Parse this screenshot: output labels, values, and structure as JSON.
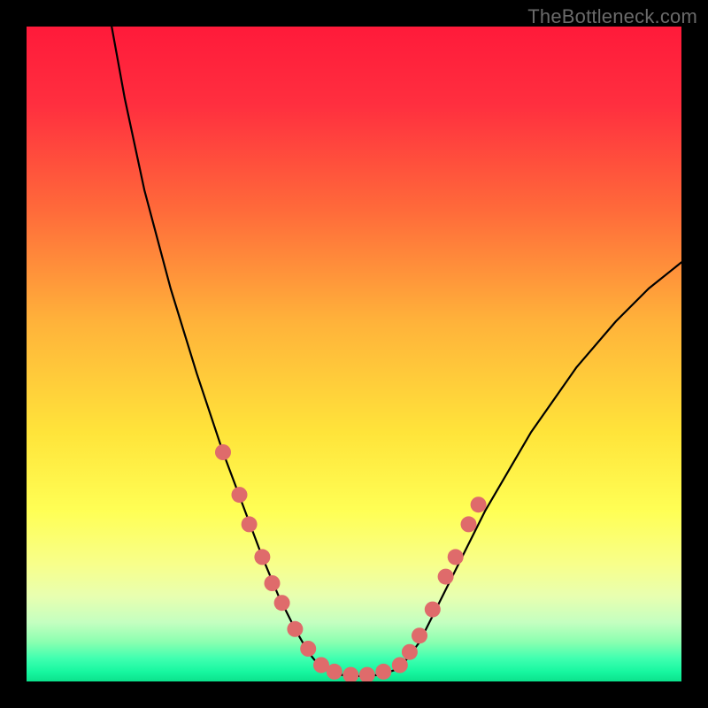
{
  "watermark": "TheBottleneck.com",
  "chart_data": {
    "type": "line",
    "title": "",
    "xlabel": "",
    "ylabel": "",
    "xlim": [
      0,
      100
    ],
    "ylim": [
      0,
      100
    ],
    "grid": false,
    "legend": false,
    "background_gradient_stops": [
      {
        "offset": 0.0,
        "color": "#ff1a3a"
      },
      {
        "offset": 0.12,
        "color": "#ff2f3f"
      },
      {
        "offset": 0.28,
        "color": "#ff6a3a"
      },
      {
        "offset": 0.45,
        "color": "#ffb23a"
      },
      {
        "offset": 0.62,
        "color": "#ffe43a"
      },
      {
        "offset": 0.74,
        "color": "#ffff55"
      },
      {
        "offset": 0.82,
        "color": "#f8ff8a"
      },
      {
        "offset": 0.87,
        "color": "#e8ffb0"
      },
      {
        "offset": 0.91,
        "color": "#c4ffc0"
      },
      {
        "offset": 0.94,
        "color": "#8affb0"
      },
      {
        "offset": 0.965,
        "color": "#3fffb0"
      },
      {
        "offset": 0.985,
        "color": "#17f7a0"
      },
      {
        "offset": 1.0,
        "color": "#0be28c"
      }
    ],
    "series": [
      {
        "name": "left-curve",
        "color": "#000000",
        "width": 2.2,
        "x": [
          13.0,
          15.0,
          18.0,
          22.0,
          26.0,
          30.0,
          33.0,
          36.0,
          38.5,
          41.0,
          43.0,
          45.0
        ],
        "y": [
          100.0,
          89.0,
          75.0,
          60.0,
          47.0,
          35.0,
          27.0,
          19.0,
          13.0,
          8.0,
          4.5,
          2.0
        ]
      },
      {
        "name": "valley-floor",
        "color": "#000000",
        "width": 2.2,
        "x": [
          45.0,
          48.0,
          51.0,
          54.0,
          57.0
        ],
        "y": [
          2.0,
          1.0,
          0.8,
          1.0,
          2.0
        ]
      },
      {
        "name": "right-curve",
        "color": "#000000",
        "width": 2.2,
        "x": [
          57.0,
          60.0,
          64.0,
          70.0,
          77.0,
          84.0,
          90.0,
          95.0,
          100.0
        ],
        "y": [
          2.0,
          6.0,
          14.0,
          26.0,
          38.0,
          48.0,
          55.0,
          60.0,
          64.0
        ]
      }
    ],
    "dots": {
      "name": "highlight-dots",
      "color": "#df6b6b",
      "radius": 9,
      "points": [
        {
          "x": 30.0,
          "y": 35.0
        },
        {
          "x": 32.5,
          "y": 28.5
        },
        {
          "x": 34.0,
          "y": 24.0
        },
        {
          "x": 36.0,
          "y": 19.0
        },
        {
          "x": 37.5,
          "y": 15.0
        },
        {
          "x": 39.0,
          "y": 12.0
        },
        {
          "x": 41.0,
          "y": 8.0
        },
        {
          "x": 43.0,
          "y": 5.0
        },
        {
          "x": 45.0,
          "y": 2.5
        },
        {
          "x": 47.0,
          "y": 1.5
        },
        {
          "x": 49.5,
          "y": 1.0
        },
        {
          "x": 52.0,
          "y": 1.0
        },
        {
          "x": 54.5,
          "y": 1.5
        },
        {
          "x": 57.0,
          "y": 2.5
        },
        {
          "x": 58.5,
          "y": 4.5
        },
        {
          "x": 60.0,
          "y": 7.0
        },
        {
          "x": 62.0,
          "y": 11.0
        },
        {
          "x": 64.0,
          "y": 16.0
        },
        {
          "x": 65.5,
          "y": 19.0
        },
        {
          "x": 67.5,
          "y": 24.0
        },
        {
          "x": 69.0,
          "y": 27.0
        }
      ]
    }
  }
}
